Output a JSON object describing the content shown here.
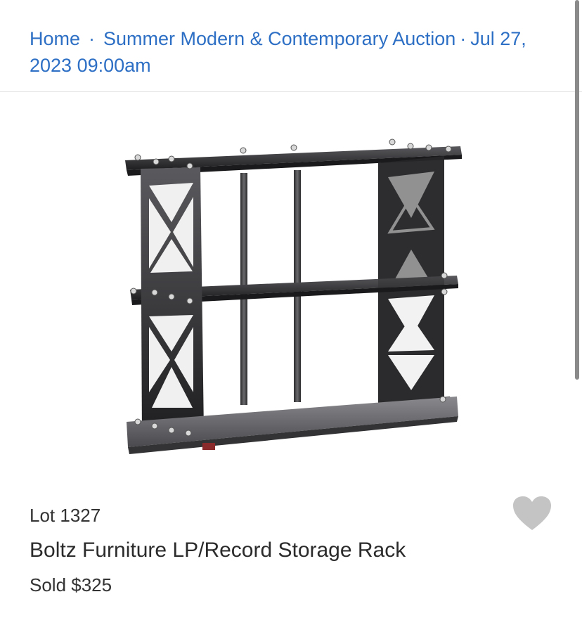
{
  "breadcrumb": {
    "home": "Home",
    "separator": "·",
    "auction": "Summer Modern & Contemporary Auction",
    "date_line1": "Jul 27,",
    "date_line2": "2023 09:00am"
  },
  "lot": {
    "number": "Lot 1327",
    "title": "Boltz Furniture LP/Record Storage Rack",
    "price": "Sold $325"
  },
  "icons": {
    "favorite": "heart-icon"
  },
  "colors": {
    "link": "#2d6fc4",
    "heart": "#c4c4c4",
    "text": "#333333"
  }
}
